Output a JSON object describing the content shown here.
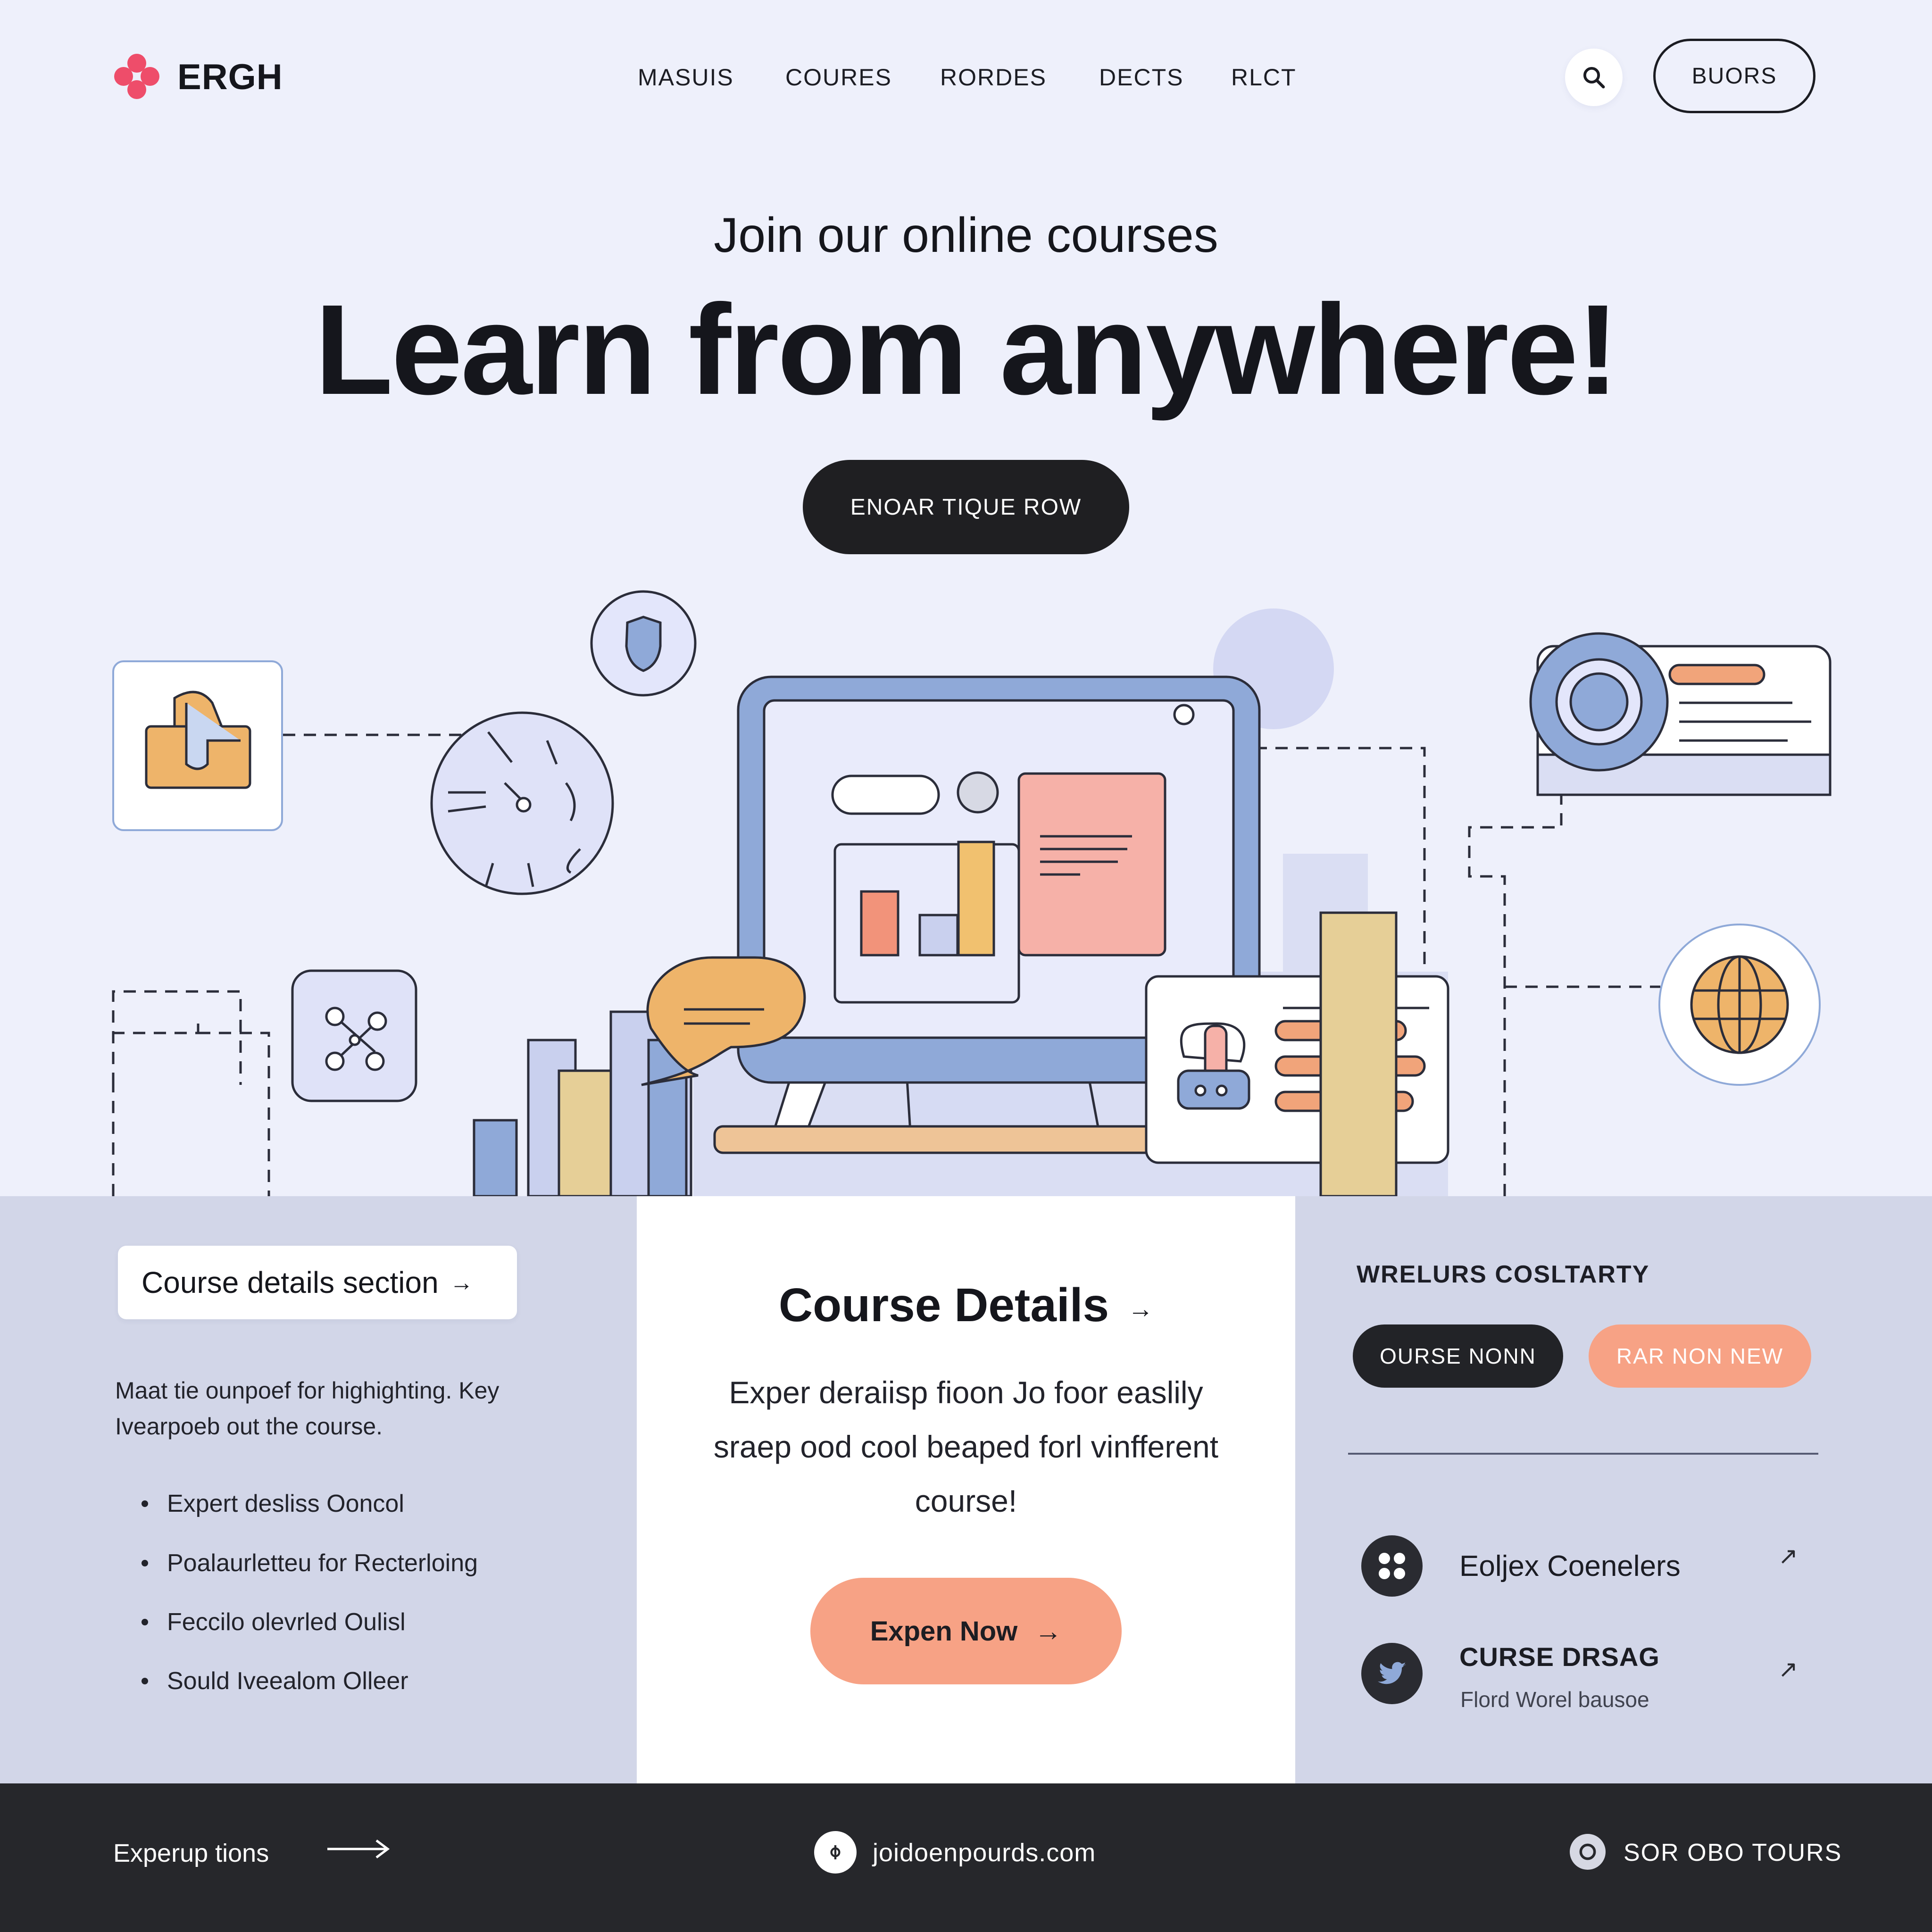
{
  "nav": {
    "brand": "ERGH",
    "links": [
      "MASUIS",
      "COURES",
      "RORDES",
      "DECTS",
      "RLCT"
    ],
    "signin_label": "BUORS"
  },
  "hero": {
    "eyebrow": "Join our online courses",
    "headline": "Learn from anywhere!",
    "cta_label": "ENOAR TIQUE ROW"
  },
  "left_panel": {
    "chip_label": "Course details section",
    "description": "Maat tie ounpoef for highighting. Key Ivearpoeb out the course.",
    "bullets": [
      "Expert desliss Ooncol",
      "Poalaurletteu for Recterloing",
      "Feccilo olevrled Oulisl",
      "Sould Iveealom Olleer"
    ]
  },
  "center_panel": {
    "title": "Course Details",
    "body": "Exper deraiisp fioon Jo foor easlily sraep ood cool beaped forl vinfferent course!",
    "button_label": "Expen Now"
  },
  "right_panel": {
    "heading": "WRELURS COSLTARTY",
    "pill_dark": "OURSE NONN",
    "pill_orange": "RAR NON NEW",
    "items": [
      {
        "title": "Eoljex Coenelers",
        "icon": "grid-dots-icon"
      },
      {
        "title": "CURSE DRSAG",
        "subtitle": "Flord Worel bausoe",
        "icon": "twitter-bird-icon"
      }
    ]
  },
  "footer": {
    "left": "Experup tions",
    "email": "joidoenpourds.com",
    "right": "SOR OBO TOURS"
  },
  "colors": {
    "accent": "#f7a285",
    "brand_pink": "#ee4d6a",
    "dark": "#222327",
    "panel": "#d2d6e8",
    "background": "#eef0fb"
  }
}
